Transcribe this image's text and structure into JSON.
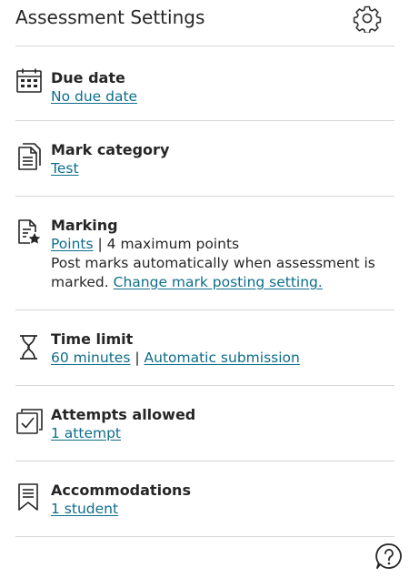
{
  "header": {
    "title": "Assessment Settings",
    "settings_icon": "gear-icon"
  },
  "due_date": {
    "label": "Due date",
    "value": "No due date",
    "icon": "calendar-icon"
  },
  "mark_category": {
    "label": "Mark category",
    "value": "Test",
    "icon": "document-icon"
  },
  "marking": {
    "label": "Marking",
    "scheme": "Points",
    "separator": "|",
    "max_points": "4 maximum points",
    "post_text": "Post marks automatically when assessment is marked.",
    "change_link": "Change mark posting setting.",
    "icon": "document-star-icon"
  },
  "time_limit": {
    "label": "Time limit",
    "value": "60 minutes",
    "separator": "|",
    "submission": "Automatic submission",
    "icon": "hourglass-icon"
  },
  "attempts": {
    "label": "Attempts allowed",
    "value": "1 attempt",
    "icon": "checkbox-stack-icon"
  },
  "accommodations": {
    "label": "Accommodations",
    "value": "1 student",
    "icon": "bookmark-icon"
  },
  "footer": {
    "help_icon": "help-icon"
  }
}
